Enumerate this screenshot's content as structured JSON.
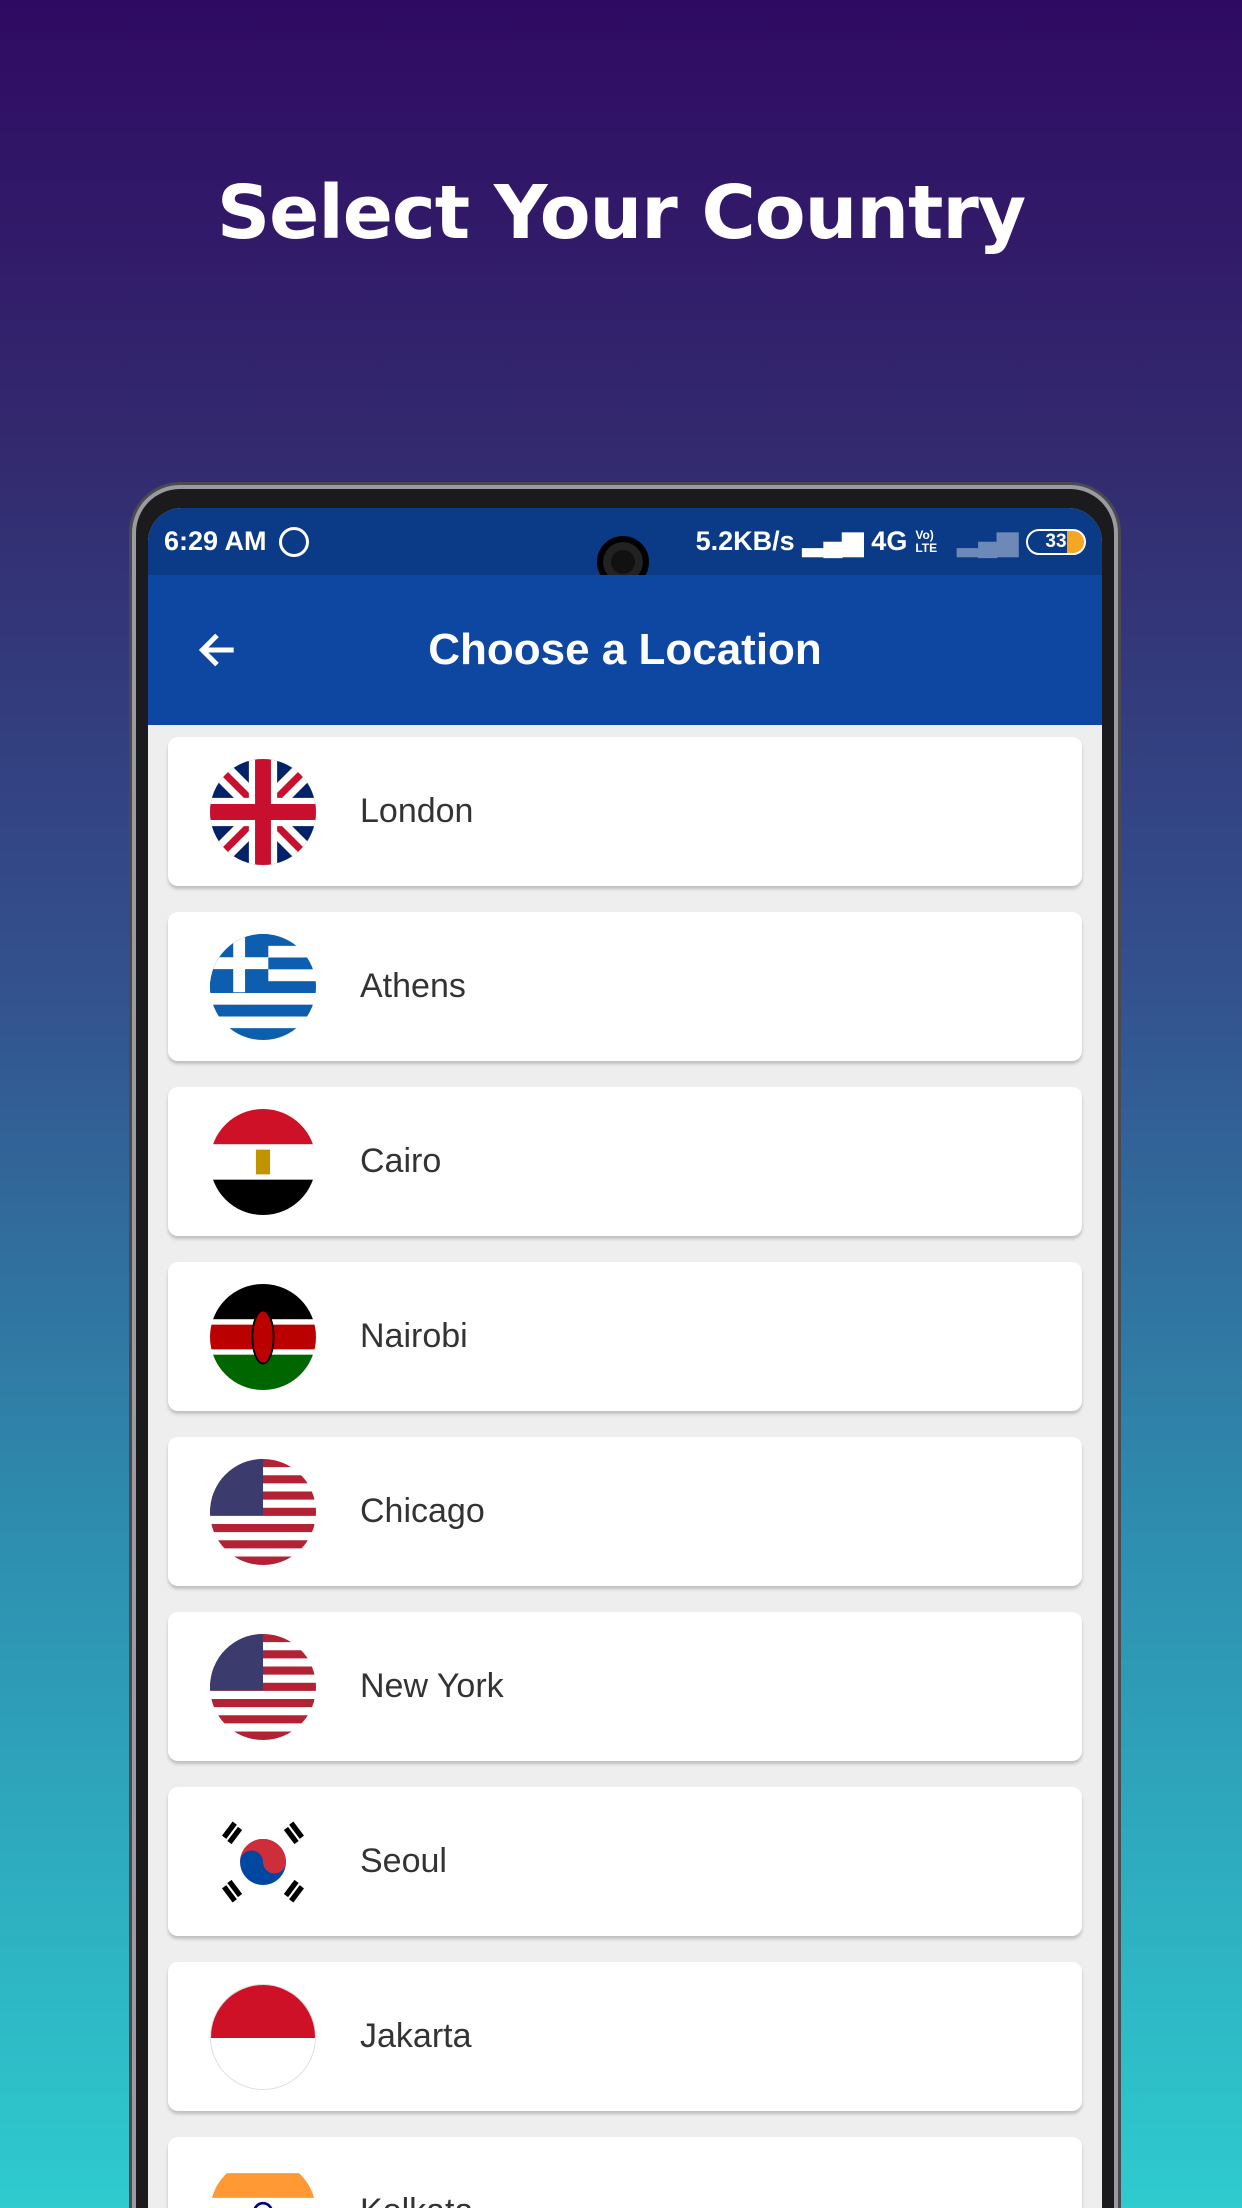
{
  "headline": "Select Your Country",
  "status_bar": {
    "time": "6:29 AM",
    "app_icon": "whatsapp-icon",
    "speed": "5.2KB/s",
    "network": "4G",
    "volte": "Vo) LTE",
    "battery": "33"
  },
  "app_bar": {
    "title": "Choose a Location",
    "back_icon": "arrow-left-icon"
  },
  "locations": [
    {
      "name": "London",
      "flag": "uk"
    },
    {
      "name": "Athens",
      "flag": "greece"
    },
    {
      "name": "Cairo",
      "flag": "egypt"
    },
    {
      "name": "Nairobi",
      "flag": "kenya"
    },
    {
      "name": "Chicago",
      "flag": "usa"
    },
    {
      "name": "New York",
      "flag": "usa"
    },
    {
      "name": "Seoul",
      "flag": "south-korea"
    },
    {
      "name": "Jakarta",
      "flag": "indonesia"
    },
    {
      "name": "Kolkata",
      "flag": "india"
    }
  ],
  "colors": {
    "app_bar": "#0d47a1",
    "status_bar": "#0b3a87",
    "list_bg": "#eeeeee"
  }
}
